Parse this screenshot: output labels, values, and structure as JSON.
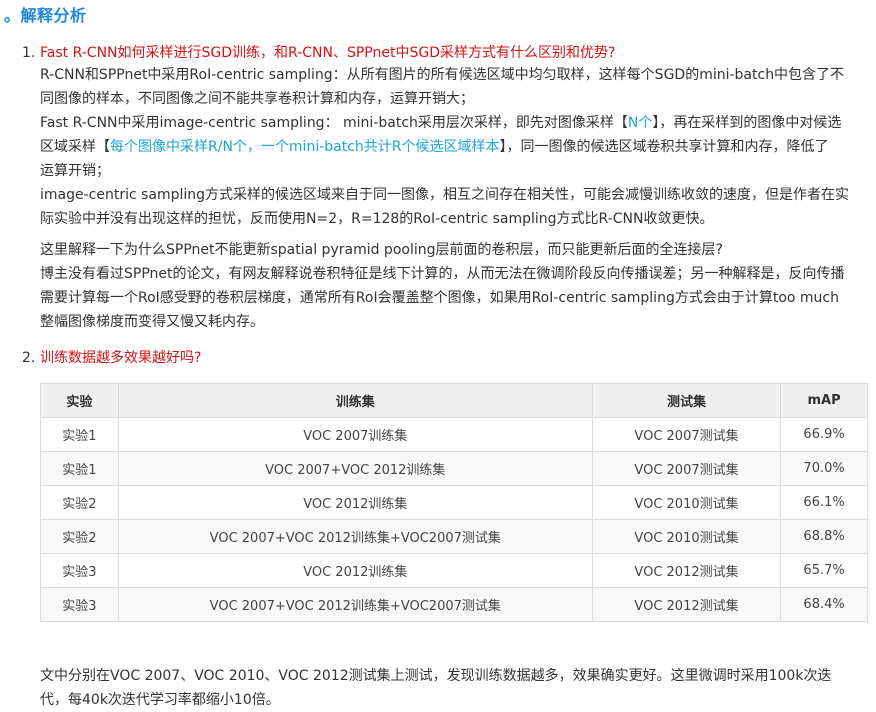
{
  "heading": "。解释分析",
  "q1": {
    "num": "1.",
    "title": "Fast R-CNN如何采样进行SGD训练，和R-CNN、SPPnet中SGD采样方式有什么区别和优势?",
    "line1": "R-CNN和SPPnet中采用RoI-centric sampling：从所有图片的所有候选区域中均匀取样，这样每个SGD的mini-batch中包含了不",
    "line2": "同图像的样本，不同图像之间不能共享卷积计算和内存，运算开销大；",
    "line3_a": "Fast R-CNN中采用image-centric sampling： mini-batch采用层次采样，即先对图像采样【",
    "line3_hl": "N个",
    "line3_b": "】，再在采样到的图像中对候选",
    "line4_a": "区域采样【",
    "line4_hl": "每个图像中采样R/N个，一个mini-batch共计R个候选区域样本",
    "line4_b": "】，同一图像的候选区域卷积共享计算和内存，降低了",
    "line5": "运算开销；",
    "line6": "image-centric sampling方式采样的候选区域来自于同一图像，相互之间存在相关性，可能会减慢训练收敛的速度，但是作者在实",
    "line7": "际实验中并没有出现这样的担忧，反而使用N=2，R=128的RoI-centric sampling方式比R-CNN收敛更快。"
  },
  "explain": {
    "line1": "这里解释一下为什么SPPnet不能更新spatial pyramid pooling层前面的卷积层，而只能更新后面的全连接层?",
    "line2": "博主没有看过SPPnet的论文，有网友解释说卷积特征是线下计算的，从而无法在微调阶段反向传播误差；另一种解释是，反向传播",
    "line3": "需要计算每一个RoI感受野的卷积层梯度，通常所有RoI会覆盖整个图像，如果用RoI-centric sampling方式会由于计算too much",
    "line4": "整幅图像梯度而变得又慢又耗内存。"
  },
  "q2": {
    "num": "2.",
    "title": "训练数据越多效果越好吗?"
  },
  "table": {
    "headers": [
      "实验",
      "训练集",
      "测试集",
      "mAP"
    ],
    "rows": [
      [
        "实验1",
        "VOC 2007训练集",
        "VOC 2007测试集",
        "66.9%"
      ],
      [
        "实验1",
        "VOC 2007+VOC 2012训练集",
        "VOC 2007测试集",
        "70.0%"
      ],
      [
        "实验2",
        "VOC 2012训练集",
        "VOC 2010测试集",
        "66.1%"
      ],
      [
        "实验2",
        "VOC 2007+VOC 2012训练集+VOC2007测试集",
        "VOC 2010测试集",
        "68.8%"
      ],
      [
        "实验3",
        "VOC 2012训练集",
        "VOC 2012测试集",
        "65.7%"
      ],
      [
        "实验3",
        "VOC 2007+VOC 2012训练集+VOC2007测试集",
        "VOC 2012测试集",
        "68.4%"
      ]
    ]
  },
  "footer": {
    "line1": "文中分别在VOC 2007、VOC 2010、VOC 2012测试集上测试，发现训练数据越多，效果确实更好。这里微调时采用100k次迭",
    "line2": "代，每40k次迭代学习率都缩小10倍。"
  }
}
